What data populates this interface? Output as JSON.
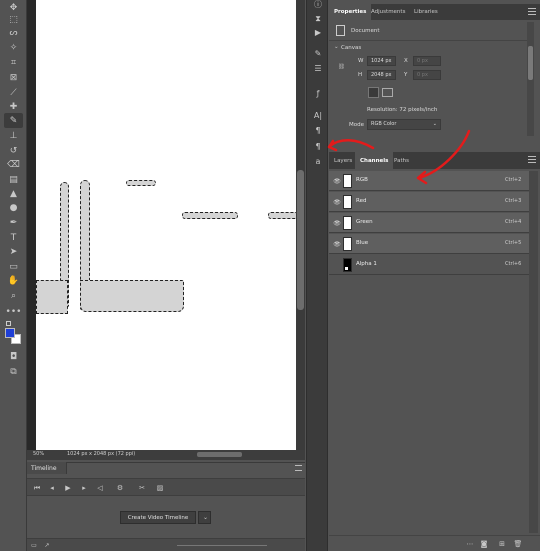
{
  "properties_panel": {
    "tabs": [
      "Properties",
      "Adjustments",
      "Libraries"
    ],
    "doc_label": "Document",
    "canvas_heading": "Canvas",
    "w_label": "W",
    "w_value": "1024 px",
    "h_label": "H",
    "h_value": "2048 px",
    "x_label": "X",
    "x_value": "0 px",
    "y_label": "Y",
    "y_value": "0 px",
    "resolution": "Resolution: 72 pixels/inch",
    "mode_label": "Mode",
    "mode_value": "RGB Color"
  },
  "channels_panel": {
    "tabs": [
      "Layers",
      "Channels",
      "Paths"
    ],
    "active_tab": "Channels",
    "channels": [
      {
        "name": "RGB",
        "shortcut": "Ctrl+2",
        "visible": true,
        "thumb": "white"
      },
      {
        "name": "Red",
        "shortcut": "Ctrl+3",
        "visible": true,
        "thumb": "white"
      },
      {
        "name": "Green",
        "shortcut": "Ctrl+4",
        "visible": true,
        "thumb": "white"
      },
      {
        "name": "Blue",
        "shortcut": "Ctrl+5",
        "visible": true,
        "thumb": "white"
      },
      {
        "name": "Alpha 1",
        "shortcut": "Ctrl+6",
        "visible": false,
        "thumb": "black"
      }
    ]
  },
  "status_bar": {
    "zoom": "50%",
    "doc_info": "1024 px x 2048 px (72 ppi)"
  },
  "timeline": {
    "tab_label": "Timeline",
    "create_button": "Create Video Timeline"
  },
  "colors": {
    "foreground": "#1f3fd6",
    "background": "#ffffff",
    "annotation": "#e31b1b"
  }
}
